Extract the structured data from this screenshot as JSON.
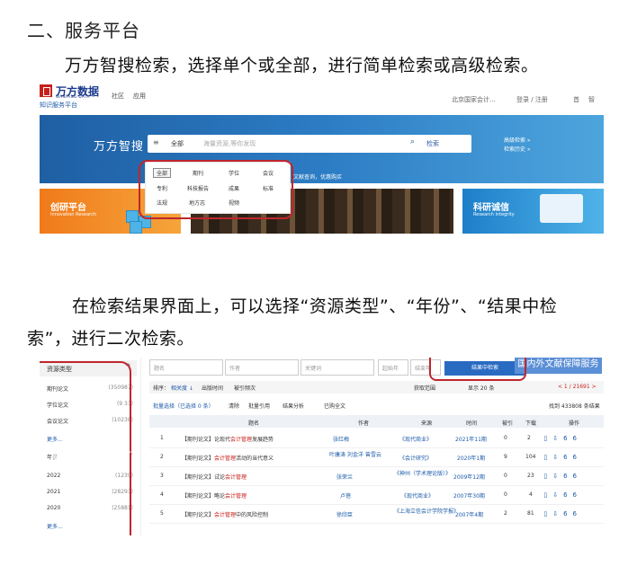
{
  "doc": {
    "heading": "二、服务平台",
    "para1": "万方智搜检索，选择单个或全部，进行简单检索或高级检索。",
    "para2_line1": "在检索结果界面上，可以选择“资源类型”、“年份”、“结果中检",
    "para2_line2": "索”，进行二次检索。"
  },
  "shot1": {
    "logo": "万方数据",
    "logo_sub": "WANFANG DATA",
    "logo_tag": "知识服务平台",
    "nav": [
      "社区",
      "应用"
    ],
    "top_right": [
      "北京国家会计...",
      "登录 / 注册",
      "首",
      "智"
    ],
    "brand": "万方智搜",
    "search": {
      "menu_icon": "≡",
      "scope": "全部",
      "placeholder": "海量资源,等你发现",
      "button": "检索"
    },
    "adv": [
      "高级检索 »",
      "检索历史 »"
    ],
    "dropdown": [
      "全部",
      "期刊",
      "学位",
      "会议",
      "专利",
      "科技报告",
      "成果",
      "标准",
      "法规",
      "地方志",
      "视频"
    ],
    "tiles": [
      {
        "title": "创研平台",
        "sub": "Innovation Research"
      },
      {
        "title": "科研诚信",
        "sub": "Research integrity"
      }
    ],
    "hint": "文献查询，优惠购买"
  },
  "shot2": {
    "side_title": "资源类型",
    "types": [
      {
        "name": "期刊论文",
        "count": "(350987)"
      },
      {
        "name": "学位论文",
        "count": "(9 33)"
      },
      {
        "name": "会议论文",
        "count": "(10238)"
      }
    ],
    "more": "更多...",
    "year_label": "年份",
    "years": [
      {
        "name": "2022",
        "count": "(1239)"
      },
      {
        "name": "2021",
        "count": "(28293)"
      },
      {
        "name": "2020",
        "count": "(25881)"
      }
    ],
    "more2": "更多...",
    "filters": [
      "题名",
      "作者",
      "关键词",
      "起始年",
      "结束年"
    ],
    "search_in": "结果中检索",
    "svc": "国内外文献保障服务",
    "sort": [
      "排序：",
      "相关度 ↓",
      "出版时间",
      "被引频次"
    ],
    "sort_right": [
      "获取范围",
      "显示 20 条",
      "< 1 / 21691 >"
    ],
    "found": "找到 433808 条结果",
    "toolbar": [
      "批量选择（已选择 0 条）",
      "清除",
      "批量引用",
      "结果分析",
      "已购全文"
    ],
    "cols": [
      "题名",
      "作者",
      "来源",
      "时间",
      "被引",
      "下载",
      "操作"
    ],
    "rows": [
      {
        "n": "1",
        "type": "【期刊论文】",
        "t1": "论现代",
        "t2": "会计管理",
        "t3": "发展趋势",
        "author": "张红梅",
        "source": "《现代商业》",
        "date": "2021年11期",
        "cited": "0",
        "dl": "2"
      },
      {
        "n": "2",
        "type": "【期刊论文】",
        "t1": "",
        "t2": "会计管理",
        "t3": "活动的当代意义",
        "author": "叶康涛  刘金洋  曾雪云",
        "source": "《会计研究》",
        "date": "2020年1期",
        "cited": "9",
        "dl": "104"
      },
      {
        "n": "3",
        "type": "【期刊论文】",
        "t1": "试论",
        "t2": "会计管理",
        "t3": "",
        "author": "张荣兰",
        "source": "《神州（学术理论版）》",
        "date": "2009年12期",
        "cited": "0",
        "dl": "23"
      },
      {
        "n": "4",
        "type": "【期刊论文】",
        "t1": "略论",
        "t2": "会计管理",
        "t3": "",
        "author": "卢蓓",
        "source": "《现代商业》",
        "date": "2007年30期",
        "cited": "0",
        "dl": "4"
      },
      {
        "n": "5",
        "type": "【期刊论文】",
        "t1": "",
        "t2": "会计管理",
        "t3": "中的风险控制",
        "author": "徐欣臣",
        "source": "《上海立信会计学院学报》",
        "date": "2007年4期",
        "cited": "2",
        "dl": "81"
      }
    ],
    "faded_text": "果界面上，可"
  },
  "colors": {
    "red_circle": "#c0262d",
    "banner": "#2c7cc4",
    "logo_red": "#c7201b",
    "link_blue": "#1b5aa8"
  }
}
